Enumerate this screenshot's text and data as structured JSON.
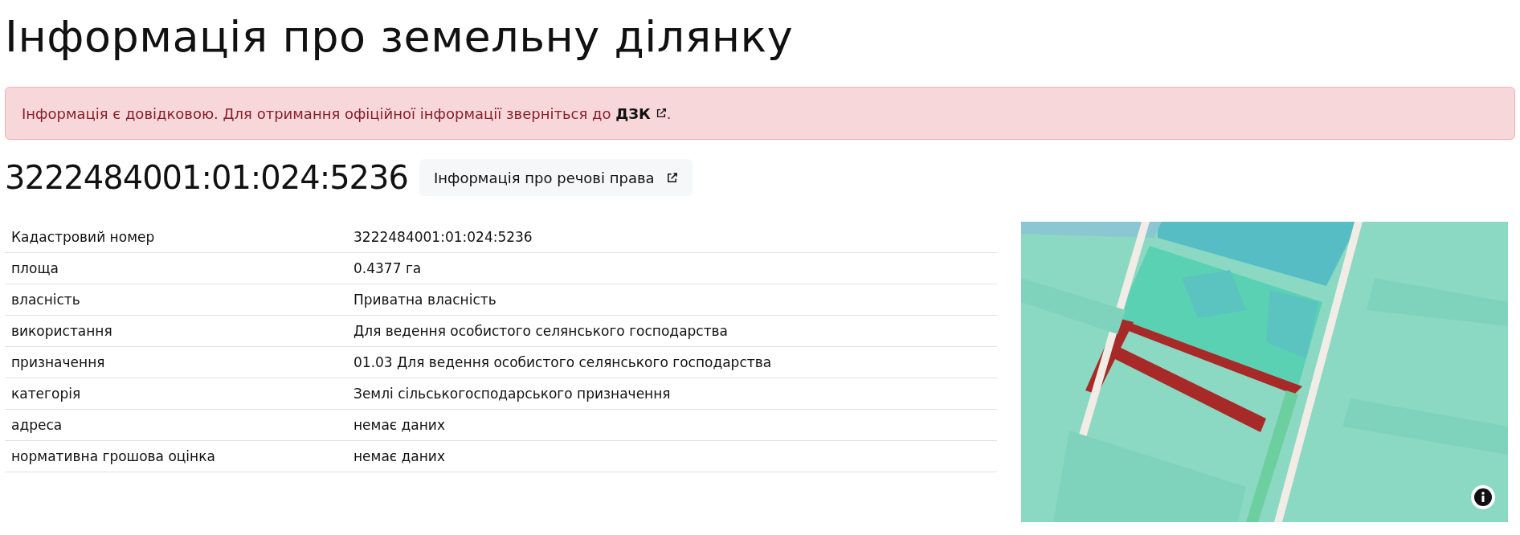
{
  "title": "Інформація про земельну ділянку",
  "alert": {
    "text": "Інформація є довідковою. Для отримання офіційної інформації зверніться до ",
    "link": "ДЗК",
    "text_after": "."
  },
  "cadastral_number": "3222484001:01:024:5236",
  "rights_button": "Інформація про речові права",
  "table": {
    "rows": [
      {
        "label": "Кадастровий номер",
        "value": "3222484001:01:024:5236"
      },
      {
        "label": "площа",
        "value": "0.4377 га"
      },
      {
        "label": "власність",
        "value": "Приватна власність"
      },
      {
        "label": "використання",
        "value": "Для ведення особистого селянського господарства"
      },
      {
        "label": "призначення",
        "value": "01.03 Для ведення особистого селянського господарства"
      },
      {
        "label": "категорія",
        "value": "Землі сільськогосподарського призначення"
      },
      {
        "label": "адреса",
        "value": "немає даних"
      },
      {
        "label": "нормативна грошова оцінка",
        "value": "немає даних"
      }
    ]
  }
}
